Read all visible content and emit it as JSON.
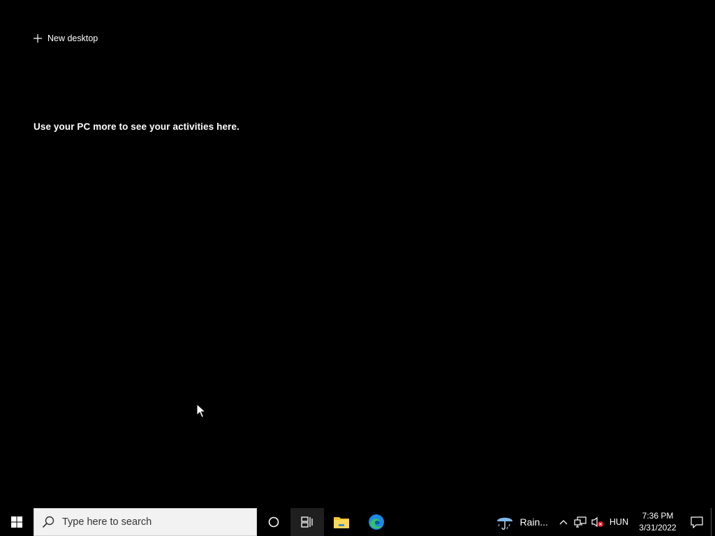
{
  "taskview": {
    "new_desktop_label": "New desktop",
    "activities_message": "Use your PC more to see your activities here."
  },
  "taskbar": {
    "search_placeholder": "Type here to search",
    "weather_text": "Rain...",
    "language": "HUN",
    "time": "7:36 PM",
    "date": "3/31/2022"
  },
  "icons": {
    "start": "windows-logo-icon",
    "search": "magnifier-icon",
    "cortana": "cortana-circle-icon",
    "task_view": "task-view-icon",
    "file_explorer": "folder-icon",
    "edge": "edge-browser-icon",
    "weather": "umbrella-rain-icon",
    "tray_chevron": "chevron-up-icon",
    "network": "network-icon",
    "volume": "volume-muted-icon",
    "notifications": "action-center-icon"
  },
  "colors": {
    "background": "#000000",
    "search_box": "#f2f2f2",
    "folder_yellow": "#f3c53c",
    "edge_blue": "#1e88e5",
    "edge_green": "#36c06a",
    "mute_red": "#e81123"
  }
}
